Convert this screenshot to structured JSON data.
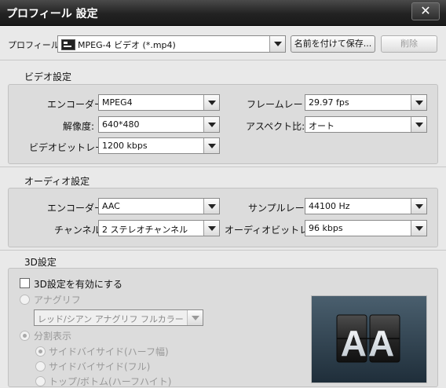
{
  "window": {
    "title": "プロフィール 設定",
    "close_symbol": "✕"
  },
  "profile": {
    "label": "プロフィール:",
    "value": "MPEG-4 ビデオ (*.mp4)",
    "save_as_label": "名前を付けて保存...",
    "delete_label": "削除"
  },
  "video": {
    "section_title": "ビデオ設定",
    "encoder_label": "エンコーダー:",
    "encoder_value": "MPEG4",
    "resolution_label": "解像度:",
    "resolution_value": "640*480",
    "bitrate_label": "ビデオビットレート:",
    "bitrate_value": "1200 kbps",
    "framerate_label": "フレームレート:",
    "framerate_value": "29.97 fps",
    "aspect_label": "アスペクト比:",
    "aspect_value": "オート"
  },
  "audio": {
    "section_title": "オーディオ設定",
    "encoder_label": "エンコーダー:",
    "encoder_value": "AAC",
    "channel_label": "チャンネル:",
    "channel_value": "2 ステレオチャンネル",
    "samplerate_label": "サンプルレート:",
    "samplerate_value": "44100 Hz",
    "bitrate_label": "オーディオビットレート:",
    "bitrate_value": "96 kbps"
  },
  "threed": {
    "section_title": "3D設定",
    "enable_label": "3D設定を有効にする",
    "enable_checked": false,
    "anaglyph_label": "アナグリフ",
    "anaglyph_value": "レッド/シアン アナグリフ フルカラー",
    "split_label": "分割表示",
    "options": [
      "サイドバイサイド(ハーフ幅)",
      "サイドバイサイド(フル)",
      "トップ/ボトム(ハーフハイト)"
    ],
    "preview_text": "AA"
  }
}
